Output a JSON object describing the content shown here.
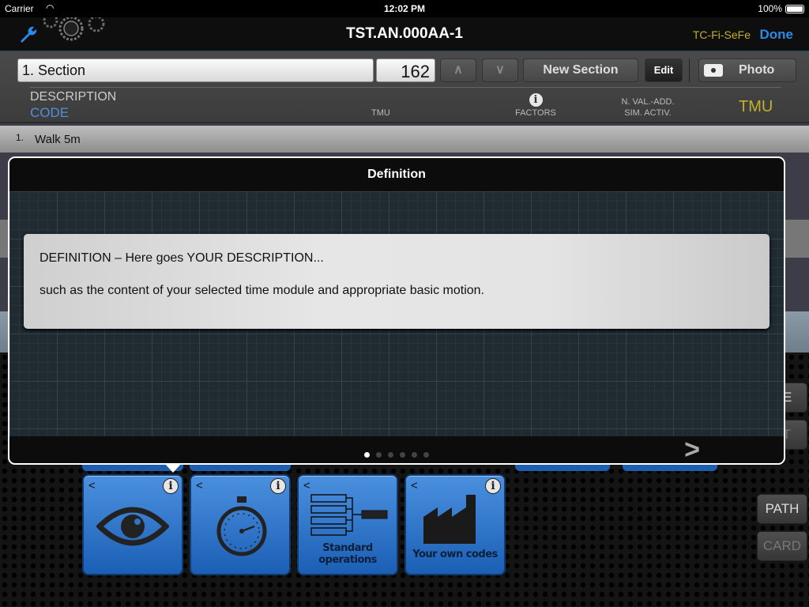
{
  "status_bar": {
    "carrier": "Carrier",
    "time": "12:02 PM",
    "battery": "100%"
  },
  "nav": {
    "title": "TST.AN.000AA-1",
    "profile": "TC-Fi-SeFe",
    "done": "Done"
  },
  "toolbar": {
    "section_value": "1. Section",
    "number_value": "162",
    "up_label": "^",
    "down_label": "v",
    "new_section": "New Section",
    "edit": "Edit",
    "photo": "Photo"
  },
  "headers": {
    "description": "DESCRIPTION",
    "code": "CODE",
    "tmu": "TMU",
    "factors": "FACTORS",
    "nval_line1": "N. VAL.-ADD.",
    "nval_line2": "SIM. ACTIV.",
    "tmu_total": "TMU"
  },
  "rows": [
    {
      "index": "1.",
      "label": "Walk 5m"
    }
  ],
  "popover": {
    "title": "Definition",
    "line1": "DEFINITION – Here goes YOUR DESCRIPTION...",
    "line2": "such as the content of your selected time module and appropriate basic motion.",
    "page_count": 6,
    "current_page": 1,
    "next_label": ">"
  },
  "tiles": [
    {
      "icon": "eye-icon",
      "label": "",
      "has_info": true
    },
    {
      "icon": "stopwatch-icon",
      "label": "",
      "has_info": true
    },
    {
      "icon": "standard-operations-icon",
      "label_line1": "Standard",
      "label_line2": "operations",
      "has_info": false
    },
    {
      "icon": "factory-icon",
      "label": "Your own codes",
      "has_info": true
    }
  ],
  "side_buttons": {
    "ge": "GE",
    "xt": "XT",
    "path": "PATH",
    "card": "CARD"
  }
}
